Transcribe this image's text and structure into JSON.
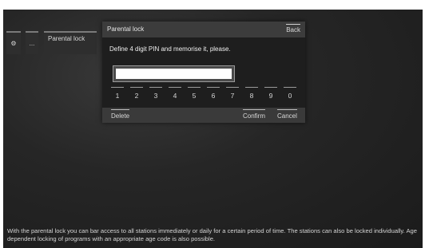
{
  "menu": {
    "gear_icon": "⚙",
    "dots": "...",
    "parental_lock": "Parental lock"
  },
  "dialog": {
    "title": "Parental lock",
    "back": "Back",
    "prompt": "Define 4 digit PIN and memorise it, please.",
    "pin_value": "",
    "digits": [
      "1",
      "2",
      "3",
      "4",
      "5",
      "6",
      "7",
      "8",
      "9",
      "0"
    ],
    "delete": "Delete",
    "confirm": "Confirm",
    "cancel": "Cancel"
  },
  "help_text": "With the parental lock you can bar access to all stations immediately or daily for a certain period of time. The stations can also be locked individually. Age dependent locking of programs with an appropriate age code is also possible."
}
